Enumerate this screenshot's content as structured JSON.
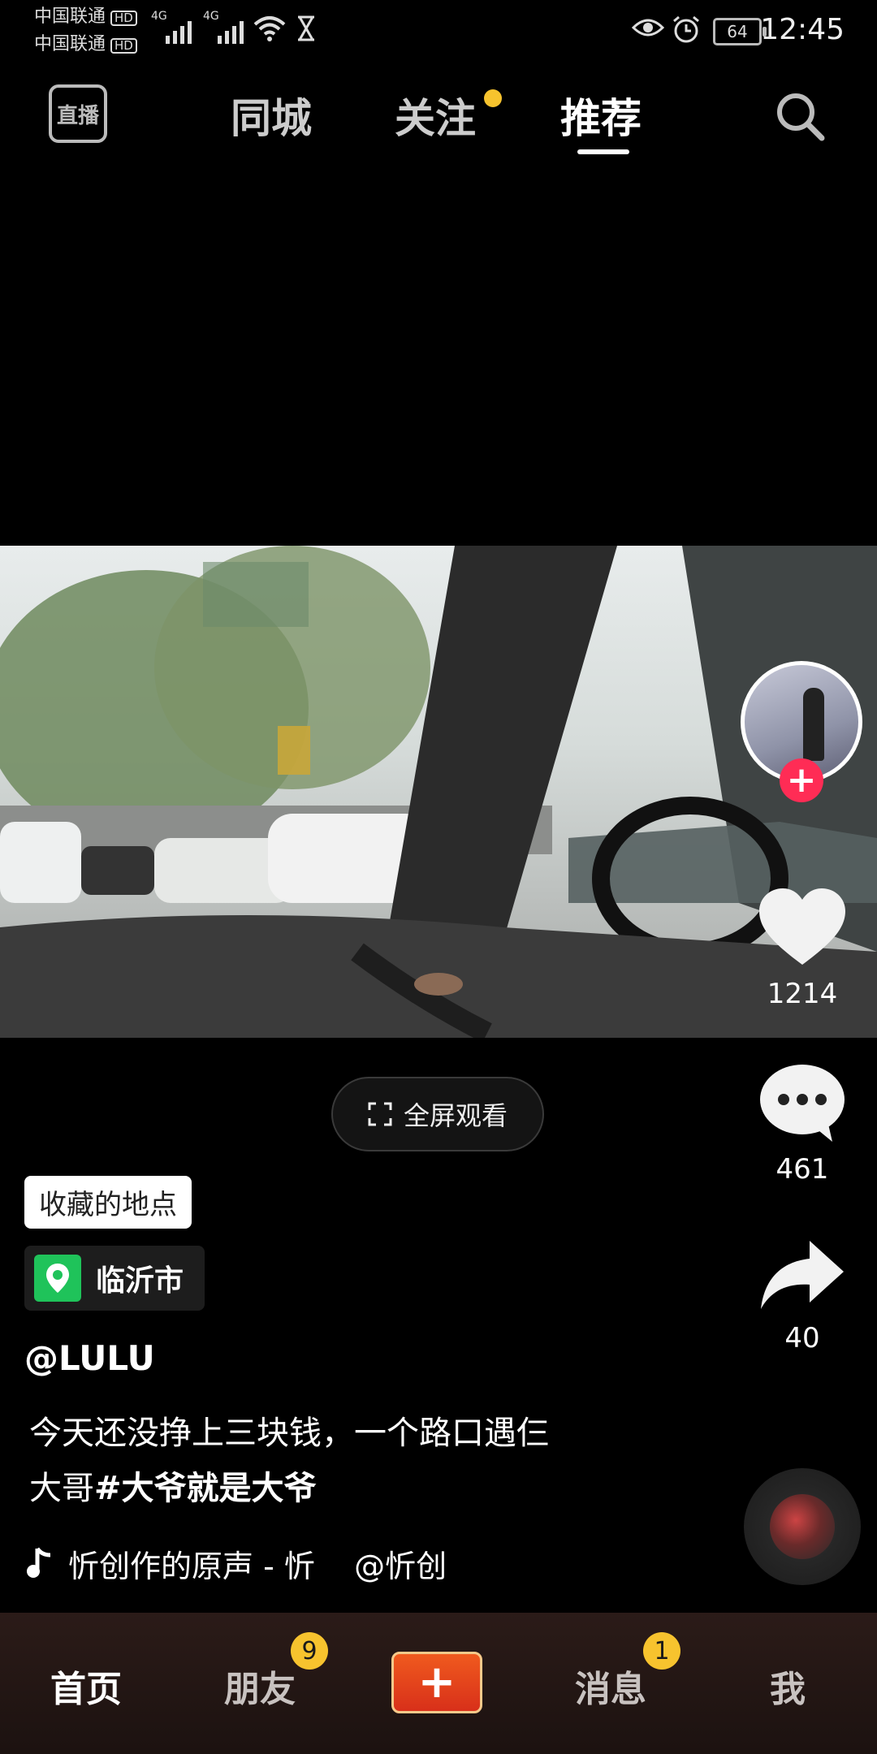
{
  "status_bar": {
    "carrier_1": "中国联通",
    "carrier_2": "中国联通",
    "hd": "HD",
    "network": "4G",
    "battery": "64",
    "time": "12:45"
  },
  "top_nav": {
    "live_label": "直播",
    "tabs": [
      "同城",
      "关注",
      "推荐"
    ],
    "active_tab": "推荐"
  },
  "video_actions": {
    "likes": "1214",
    "comments": "461",
    "shares": "40"
  },
  "fullscreen": {
    "label": "全屏观看"
  },
  "post": {
    "saved_place_tag": "收藏的地点",
    "location": "临沂市",
    "author": "@LULU",
    "caption_line1": "今天还没挣上三块钱，一个路口遇仨",
    "caption_line2_prefix": "大哥",
    "caption_hashtag": "#大爷就是大爷",
    "music": "忻创作的原声 - 忻    @忻创"
  },
  "bottom_nav": {
    "home": "首页",
    "friends": "朋友",
    "friends_badge": "9",
    "messages": "消息",
    "messages_badge": "1",
    "me": "我"
  },
  "colors": {
    "accent_yellow": "#f7c32e",
    "follow_plus": "#ff2c55",
    "location_green": "#1fc35a",
    "create_button": "#e8401c"
  },
  "icons": [
    "wifi-icon",
    "hourglass-icon",
    "eye-icon",
    "alarm-icon",
    "search-icon",
    "heart-icon",
    "comment-icon",
    "share-icon",
    "fullscreen-icon",
    "location-pin-icon",
    "music-note-icon",
    "plus-icon"
  ]
}
